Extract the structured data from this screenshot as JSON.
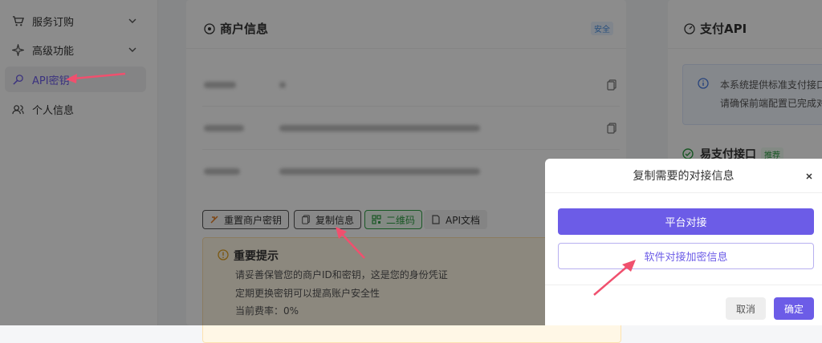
{
  "sidebar": {
    "items": [
      {
        "label": "服务订购",
        "icon": "cart-icon",
        "has_chevron": true
      },
      {
        "label": "高级功能",
        "icon": "sparkle-icon",
        "has_chevron": true
      },
      {
        "label": "API密钥",
        "icon": "key-icon",
        "active": true
      },
      {
        "label": "个人信息",
        "icon": "users-icon"
      }
    ]
  },
  "merchant_card": {
    "title": "商户信息",
    "badge": "安全",
    "buttons": {
      "reset": "重置商户密钥",
      "copy": "复制信息",
      "qrcode": "二维码",
      "docs": "API文档"
    },
    "tips": {
      "title": "重要提示",
      "lines": [
        "请妥善保管您的商户ID和密钥，这是您的身份凭证",
        "定期更换密钥可以提高账户安全性",
        "当前费率：0%"
      ]
    }
  },
  "api_card": {
    "title": "支付API",
    "info_line1": "本系统提供标准支付接口",
    "info_line2": "请确保前端配置已完成对",
    "section_title": "易支付接口",
    "section_badge": "推荐"
  },
  "dialog": {
    "title": "复制需要的对接信息",
    "btn_platform": "平台对接",
    "btn_software": "软件对接加密信息",
    "cancel": "取消",
    "confirm": "确定"
  },
  "colors": {
    "accent": "#6c5ce7",
    "annotation_arrow": "#f0506e",
    "success": "#2f9e44"
  }
}
